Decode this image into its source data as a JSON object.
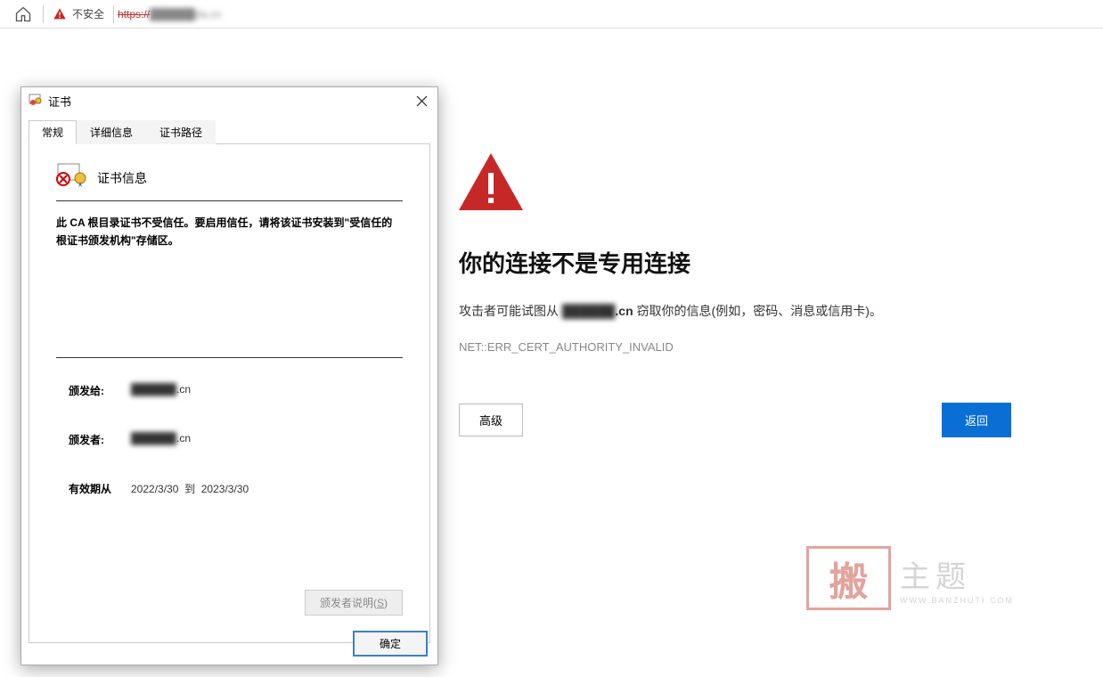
{
  "browser": {
    "insecure_label": "不安全",
    "url_protocol": "https://",
    "url_masked_host": "██████da.cn"
  },
  "warning_page": {
    "title": "你的连接不是专用连接",
    "desc_prefix": "攻击者可能试图从 ",
    "desc_domain_masked": "██████",
    "desc_domain_suffix": ".cn",
    "desc_suffix": " 窃取你的信息(例如，密码、消息或信用卡)。",
    "error_code": "NET::ERR_CERT_AUTHORITY_INVALID",
    "advanced_label": "高级",
    "back_label": "返回"
  },
  "cert_dialog": {
    "title": "证书",
    "tabs": [
      "常规",
      "详细信息",
      "证书路径"
    ],
    "active_tab": 0,
    "info_heading": "证书信息",
    "info_message": "此 CA 根目录证书不受信任。要启用信任，请将该证书安装到\"受信任的根证书颁发机构\"存储区。",
    "fields": {
      "issued_to_label": "颁发给:",
      "issued_to_value_masked": "██████",
      "issued_to_value_suffix": ".cn",
      "issuer_label": "颁发者:",
      "issuer_value_masked": "██████",
      "issuer_value_suffix": ".cn",
      "validity_label": "有效期从",
      "validity_from": "2022/3/30",
      "validity_to_word": "到",
      "validity_to": "2023/3/30"
    },
    "issuer_statement_btn": "颁发者说明(S)",
    "ok_label": "确定"
  },
  "watermark": {
    "stamp_char": "搬",
    "main": "主题",
    "sub": "WWW.BANZHUTI.COM"
  }
}
